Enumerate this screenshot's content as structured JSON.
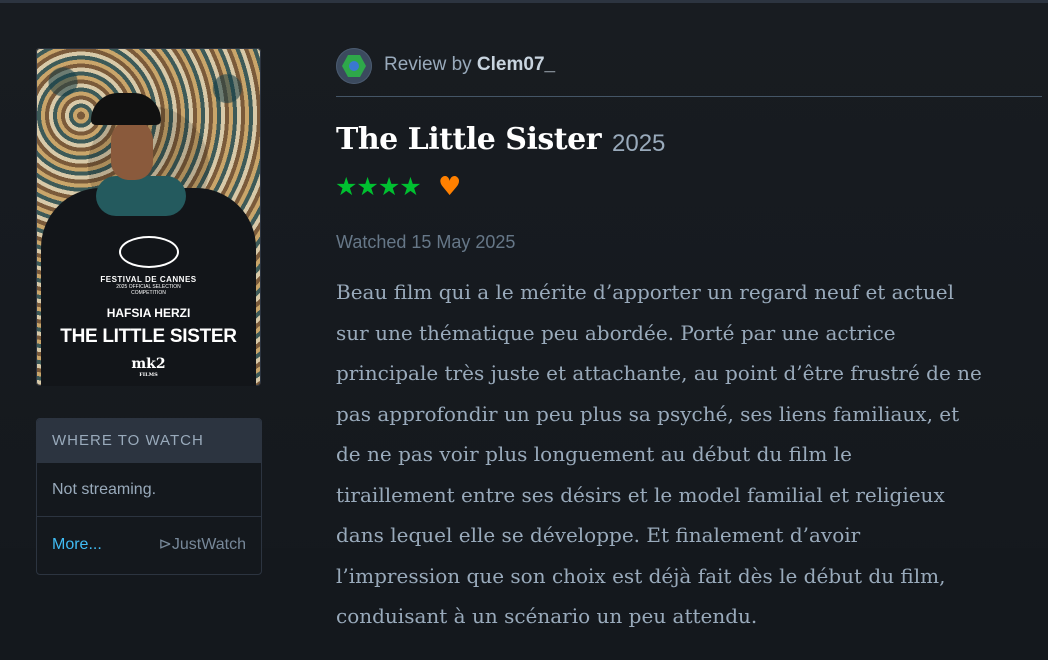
{
  "poster": {
    "festival": "FESTIVAL DE CANNES",
    "selection_line1": "2025 OFFICIAL SELECTION",
    "selection_line2": "COMPETITION",
    "actor": "HAFSIA HERZI",
    "title": "THE LITTLE SISTER",
    "distributor": "mk2",
    "distributor_sub": "FILMS"
  },
  "where_to_watch": {
    "heading": "WHERE TO WATCH",
    "status": "Not streaming.",
    "more_link": "More...",
    "provider": "⊳JustWatch"
  },
  "review": {
    "prefix": "Review by ",
    "username": "Clem07_",
    "film_title": "The Little Sister",
    "year": "2025",
    "rating_stars": 4,
    "stars_glyph": "★★★★",
    "liked": true,
    "heart_glyph": "♥",
    "watched": "Watched 15 May 2025",
    "body_lines": [
      "Beau film qui a le mérite d’apporter un regard neuf et actuel",
      "sur une thématique peu abordée. Porté par une actrice",
      "principale très juste et attachante, au point d’être frustré de ne",
      "pas approfondir un peu plus sa psyché, ses liens familiaux, et",
      "de ne pas voir plus longuement au début du film le",
      "tiraillement entre ses désirs et le model familial et religieux",
      "dans lequel elle se développe. Et finalement d’avoir",
      "l’impression que son choix est déjà fait dès le début du film,",
      "conduisant à un scénario un peu attendu."
    ]
  },
  "colors": {
    "background": "#14181d",
    "star_green": "#00c030",
    "heart_orange": "#ff8000",
    "link_blue": "#40bcf4"
  }
}
